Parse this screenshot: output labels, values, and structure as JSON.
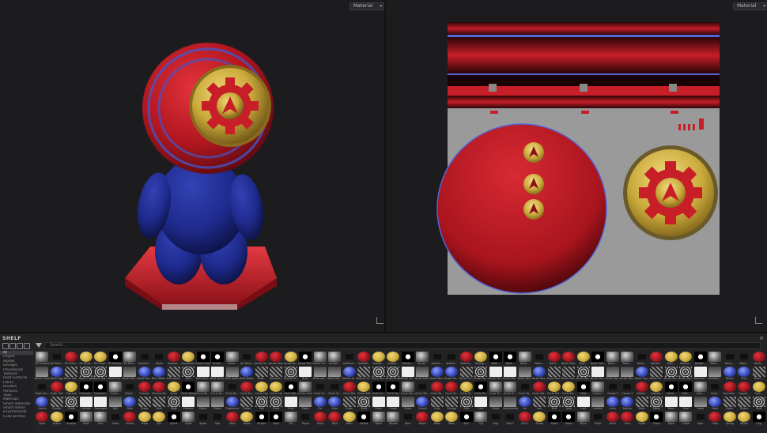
{
  "viewport3d": {
    "mode_label": "Material"
  },
  "viewport2d": {
    "mode_label": "Material"
  },
  "colors": {
    "red": "#c81e28",
    "blue": "#1e2a8c",
    "gold": "#c9a93a",
    "gray": "#9a9a9a",
    "bg": "#1c1c1f"
  },
  "shelf": {
    "title": "SHELF",
    "search_placeholder": "Search...",
    "categories": [
      "All",
      "Project",
      "Alphas",
      "Grunges",
      "Procedurals",
      "Textures",
      "Hard Surfaces",
      "Filters",
      "Brushes",
      "Particles",
      "Tools",
      "Materials",
      "Smart materials",
      "Smart masks",
      "Environments",
      "Color profiles"
    ],
    "selected_category": 0,
    "labels": [
      [
        "3D Simplex...",
        "3D Perlin...",
        "3D Perlin...",
        "3D Simpl...",
        "3D Simpl...",
        "3D Worley...",
        "3D Worl...",
        "Anisotro...",
        "Alpha",
        "Angular...",
        "Annotation...",
        "Arrow Cross",
        "Arrow...",
        "Arrow...",
        "Art Nouv...",
        "Arrow Fin...",
        "Arrow Heal...",
        "Arrow Se...",
        "Arrow Ted...",
        "Arrow Circ...",
        "Artifica...",
        "Artificial...",
        "Asphalt...",
        "Artistic...",
        "Artistic...",
        "Artistic...",
        "Arrow...",
        "Artistic...",
        "Artistic...",
        "Atlantis...",
        "Backgr...",
        "Bark...",
        "Base...",
        "Basic...",
        "Basic...",
        "Basic...",
        "Basic Hard...",
        "Bark...",
        "Basic Soft...",
        "Basic...",
        "Basic...",
        "Basic...",
        "Bandol...",
        "Bark...",
        "Basket...",
        "Basket...",
        "Basic...",
        "Basic...",
        "Basic...",
        "Basic..."
      ],
      [
        "Bevel Cross",
        "Bevel Egg",
        "Bevel Hal...",
        "Bevel Cross",
        "Bevel Hal...",
        "Bevel Rec...",
        "Bevel Rec...",
        "Bevel Rec...",
        "Blue Wate...",
        "Bnw Spots...",
        "Bolt",
        "Bolt Smal...",
        "BnW Spots...",
        "BnW Spots...",
        "BnW Spots...",
        "BnW...",
        "Brackets...",
        "Bracket B...",
        "Brick",
        "Brick poi...",
        "Brick Ger...",
        "Bronze Ar...",
        "Bronze Co...",
        "Brush Bar...",
        "Brush Brush...",
        "Brush Cir...",
        "Brush Dab...",
        "Brush Dry...",
        "Brush Fla...",
        "Brush Pai...",
        "Brush Pai...",
        "Brush Pai...",
        "Brush Pai...",
        "Brush Rou...",
        "Brush Rou...",
        "Brush Rou...",
        "Brush Sha...",
        "Brush Spl...",
        "Brush Squ...",
        "Brush Squ...",
        "Brush Squ...",
        "Brush Squ...",
        "Brush Str...",
        "Brush Str...",
        "Brush Tex...",
        "Brushed...",
        "Bubbles...",
        "Bump",
        "Burn",
        "Burnt..."
      ],
      [
        "Chalk Sm...",
        "Chalk Thin",
        "Charcoal",
        "Charcoal...",
        "Charcoal...",
        "Check...",
        "Check...",
        "Checker",
        "Chrome Bu...",
        "Circle",
        "Circle Bump",
        "Circle Bu...",
        "Circle Bu...",
        "Circle Bu...",
        "Circle Bu...",
        "Circle Cap",
        "Circle Coil",
        "Circle Dot...",
        "Circle Gear",
        "Circle Gr...",
        "Circle Gl...",
        "Circle Nut",
        "Circle Soft",
        "Circle Sq...",
        "Circle Sq...",
        "Circle Sta...",
        "Circle Ste...",
        "Circle Sq...",
        "Circle St...",
        "Circle Ta...",
        "Circle Ta...",
        "Circle To...",
        "Circle Tri...",
        "Circle Vo...",
        "Circle Wa...",
        "Circle Wh...",
        "Circle Ze...",
        "Claw",
        "Clouds 1",
        "Clouds 2",
        "Clouds 3",
        "Cobble...",
        "Cobbles...",
        "Coins...",
        "Cold...",
        "Color...",
        "Color...",
        "Concrete...",
        "Copper...",
        "Cork..."
      ],
      [
        "Cracks",
        "Crystal",
        "Curve",
        "Cylinder",
        "Damaged",
        "Dirt",
        "Dots",
        "Drops",
        "Dust",
        "Edge",
        "Emboss",
        "Fabric",
        "Fibers",
        "Fingerprint",
        "Flakes",
        "Flat",
        "Floor",
        "Fluid",
        "Foam",
        "Fur",
        "Gear",
        "Glass",
        "Gold",
        "Grain",
        "Graph",
        "Grass",
        "Gravel",
        "Grid",
        "Grunge",
        "Hair",
        "Hex",
        "Holes",
        "Honeycomb",
        "Ice",
        "Iron",
        "Knit",
        "Lava",
        "Leaf",
        "Leather",
        "Lines",
        "Marble",
        "Mesh",
        "Metal",
        "Moss",
        "Mud",
        "Noise",
        "Paint",
        "Paper",
        "Plastic",
        "Rust"
      ],
      [
        "Sand",
        "Scales",
        "Scratch",
        "Shell",
        "Skin",
        "Slate",
        "Smoke",
        "Snow",
        "Soil",
        "Spiral",
        "Splat",
        "Spots",
        "Star",
        "Steel",
        "Stone",
        "Stripes",
        "Swirl",
        "Tile",
        "Tissue",
        "Tread",
        "Twist",
        "Veins",
        "Velvet",
        "Wave",
        "Weave",
        "Wire",
        "Wood",
        "Wool",
        "Worn",
        "Zinc",
        "Zig",
        "Zag",
        "Bolt 2",
        "Nut 2",
        "Screw",
        "Rivet",
        "Seam",
        "Stitch",
        "Plate",
        "Panel",
        "Vent",
        "Grate",
        "Chain",
        "Rope",
        "Cable",
        "Pipe",
        "Hose",
        "Spring",
        "Wheel",
        "Cog"
      ]
    ]
  }
}
